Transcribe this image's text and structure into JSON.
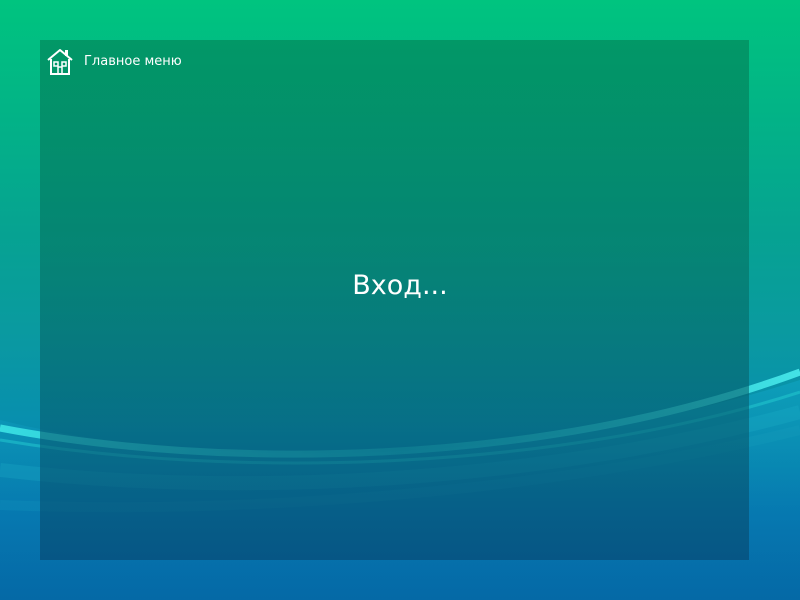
{
  "home": {
    "label": "Главное меню",
    "icon": "home-icon"
  },
  "status": {
    "text": "Вход..."
  },
  "colors": {
    "top": "#00c47f",
    "bottom": "#0569a6",
    "panel": "#03785a",
    "swoosh": "#39e6e6",
    "text": "#ffffff"
  }
}
